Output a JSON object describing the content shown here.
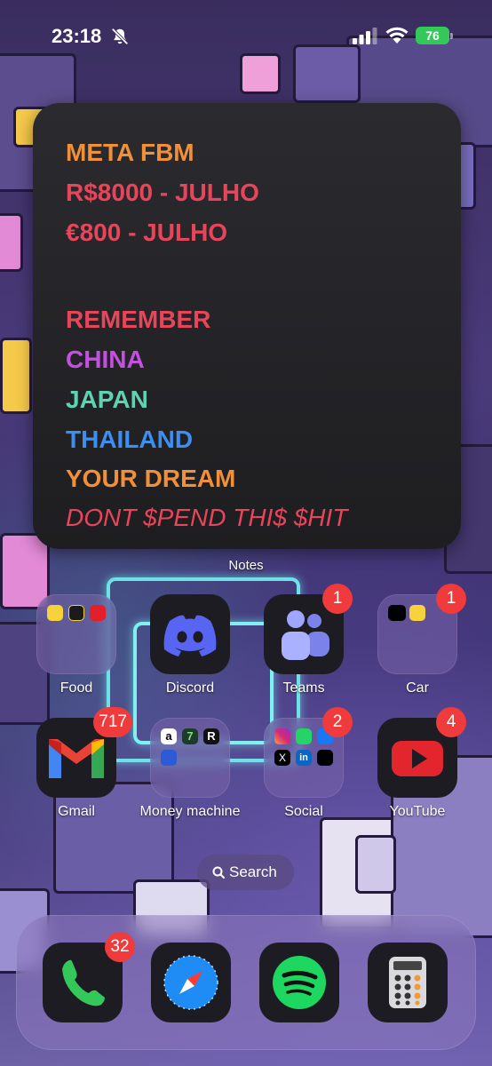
{
  "status_bar": {
    "time": "23:18",
    "battery": "76",
    "icons": [
      "bell-slash-icon",
      "cellular-signal-icon",
      "wifi-icon",
      "battery-charging-icon"
    ]
  },
  "notes_widget": {
    "label": "Notes",
    "lines": [
      {
        "text": "META FBM",
        "color": "#f0903a"
      },
      {
        "text": "R$8000 - JULHO",
        "color": "#e8455b"
      },
      {
        "text": "€800 - JULHO",
        "color": "#e8455b"
      },
      {
        "text": "REMEMBER",
        "color": "#e8455b"
      },
      {
        "text": "CHINA",
        "color": "#c44fe0"
      },
      {
        "text": "JAPAN",
        "color": "#5ed3b0"
      },
      {
        "text": "THAILAND",
        "color": "#3c8ef0"
      },
      {
        "text": "YOUR DREAM",
        "color": "#f0903a"
      },
      {
        "text": "DONT $PEND THI$ $HIT",
        "color": "#e8455b"
      }
    ]
  },
  "apps": {
    "food": {
      "label": "Food",
      "icons": [
        "aiqfome",
        "keeta",
        "ifood"
      ]
    },
    "discord": {
      "label": "Discord"
    },
    "teams": {
      "label": "Teams",
      "badge": "1"
    },
    "car": {
      "label": "Car",
      "badge": "1",
      "icons": [
        "uber",
        "99"
      ]
    },
    "gmail": {
      "label": "Gmail",
      "badge": "717"
    },
    "money": {
      "label": "Money machine",
      "icons": [
        "amazon",
        "7",
        "R",
        "cart"
      ]
    },
    "social": {
      "label": "Social",
      "badge": "2",
      "icons": [
        "instagram",
        "whatsapp",
        "facebook",
        "x",
        "linkedin",
        "tiktok"
      ]
    },
    "youtube": {
      "label": "YouTube",
      "badge": "4"
    }
  },
  "search": {
    "label": "Search"
  },
  "dock": {
    "phone": {
      "badge": "32"
    },
    "apps": [
      "phone",
      "safari",
      "spotify",
      "calculator"
    ]
  },
  "colors": {
    "badge": "#ef3b3b",
    "battery": "#34c759"
  }
}
